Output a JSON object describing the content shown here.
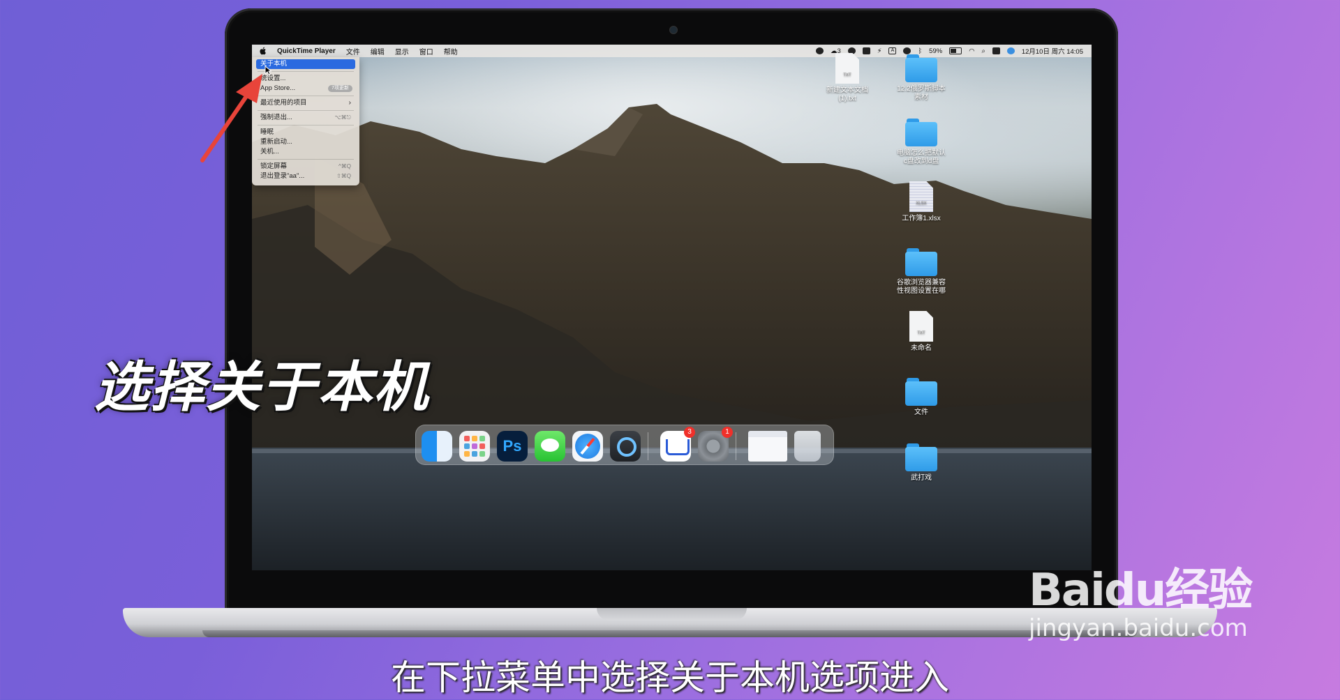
{
  "menubar": {
    "app_name": "QuickTime Player",
    "menus": [
      "文件",
      "编辑",
      "显示",
      "窗口",
      "帮助"
    ],
    "battery": "59%",
    "notif_count": "3",
    "datetime": "12月10日 周六 14:05",
    "input_mode": "A"
  },
  "apple_menu": {
    "items": [
      {
        "label": "关于本机",
        "shortcut": ""
      },
      {
        "label": "统设置...",
        "shortcut": ""
      },
      {
        "label": "App Store...",
        "badge": "7项更新"
      },
      {
        "label": "最近使用的项目",
        "shortcut": ""
      },
      {
        "label": "强制退出...",
        "shortcut": "⌥⌘⎋"
      },
      {
        "label": "睡眠",
        "shortcut": ""
      },
      {
        "label": "重新启动...",
        "shortcut": ""
      },
      {
        "label": "关机...",
        "shortcut": ""
      },
      {
        "label": "锁定屏幕",
        "shortcut": "^⌘Q"
      },
      {
        "label": "退出登录\"aa\"...",
        "shortcut": "⇧⌘Q"
      }
    ]
  },
  "desktop": {
    "icons": [
      {
        "name": "新建文本文档 (1).txt",
        "type": "doc",
        "doc_tag": "TXT"
      },
      {
        "name": "12.2俄罗斯脚本素材",
        "type": "folder"
      },
      {
        "name": "电脑怎么把默认c盘改到d盘",
        "type": "folder"
      },
      {
        "name": "工作簿1.xlsx",
        "type": "sheet",
        "doc_tag": "XLSX"
      },
      {
        "name": "谷歌浏览器兼容性视图设置在哪",
        "type": "folder"
      },
      {
        "name": "未命名",
        "type": "doc",
        "doc_tag": "TXT"
      },
      {
        "name": "文件",
        "type": "folder"
      },
      {
        "name": "武打戏",
        "type": "folder"
      }
    ]
  },
  "dock": {
    "apps": [
      {
        "name": "finder-icon"
      },
      {
        "name": "launchpad-icon"
      },
      {
        "name": "photoshop-icon",
        "label": "Ps"
      },
      {
        "name": "messages-icon"
      },
      {
        "name": "safari-icon"
      },
      {
        "name": "quicktime-icon"
      },
      {
        "name": "mail-app-icon",
        "badge": "3"
      },
      {
        "name": "system-settings-icon",
        "badge": "1"
      },
      {
        "name": "finder-window-thumbnail-icon"
      },
      {
        "name": "trash-icon"
      }
    ]
  },
  "overlay": {
    "caption": "选择关于本机",
    "subtitle": "在下拉菜单中选择关于本机选项进入",
    "watermark_logo": "Baidu经验",
    "watermark_url": "jingyan.baidu.com"
  },
  "colors": {
    "menu_highlight": "#2a6ae0",
    "folder_blue": "#3fa9f5",
    "badge_red": "#f0302a",
    "arrow_red": "#e8443a"
  }
}
